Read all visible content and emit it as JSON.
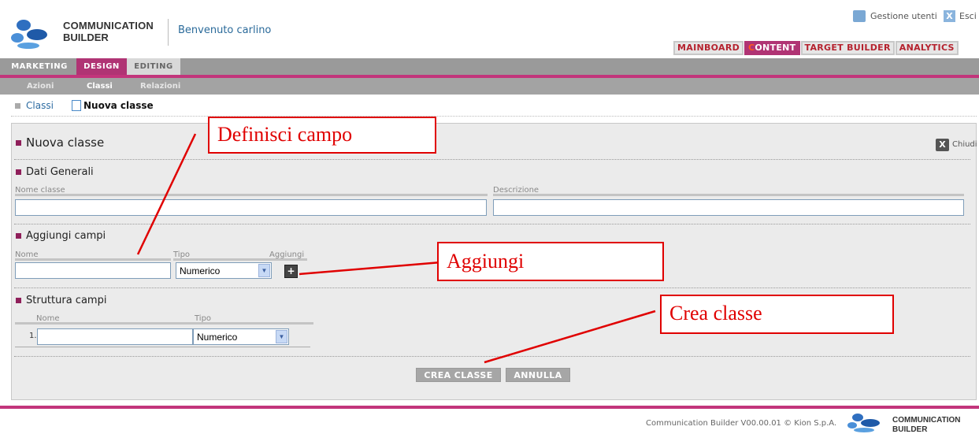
{
  "header": {
    "brand_line1": "COMMUNICATION",
    "brand_line2": "BUILDER",
    "welcome": "Benvenuto carlino",
    "user_mgmt": "Gestione utenti",
    "logout": "Esci",
    "main_tabs": [
      {
        "first": "M",
        "rest": "AINBOARD",
        "active": false
      },
      {
        "first": "C",
        "rest": "ONTENT",
        "active": true
      },
      {
        "first": "",
        "rest": "TARGET BUILDER",
        "active": false
      },
      {
        "first": "",
        "rest": "ANALYTICS",
        "active": false
      }
    ]
  },
  "nav": {
    "tabs": [
      "MARKETING",
      "DESIGN",
      "EDITING"
    ],
    "active_tab": "DESIGN",
    "subtabs": [
      "Azioni",
      "Classi",
      "Relazioni"
    ],
    "active_subtab": "Classi"
  },
  "breadcrumb": {
    "parent": "Classi",
    "current": "Nuova classe"
  },
  "panel": {
    "title": "Nuova classe",
    "close": "Chiudi",
    "general": {
      "title": "Dati Generali",
      "name_label": "Nome classe",
      "desc_label": "Descrizione",
      "name_value": "",
      "desc_value": ""
    },
    "add_fields": {
      "title": "Aggiungi campi",
      "name_label": "Nome",
      "type_label": "Tipo",
      "add_label": "Aggiungi",
      "type_value": "Numerico"
    },
    "structure": {
      "title": "Struttura campi",
      "name_label": "Nome",
      "type_label": "Tipo",
      "rows": [
        {
          "index": "1.",
          "name": "",
          "type": "Numerico"
        }
      ]
    },
    "create_btn": "CREA CLASSE",
    "cancel_btn": "ANNULLA"
  },
  "footer": {
    "text": "Communication Builder V00.00.01 © Kion S.p.A.",
    "brand_line1": "COMMUNICATION",
    "brand_line2": "BUILDER"
  },
  "annotations": {
    "define_field": "Definisci campo",
    "add": "Aggiungi",
    "create_class": "Crea classe"
  },
  "colors": {
    "accent": "#c2357b",
    "annotation": "#e00000",
    "nav_gray": "#9a9a9a"
  }
}
